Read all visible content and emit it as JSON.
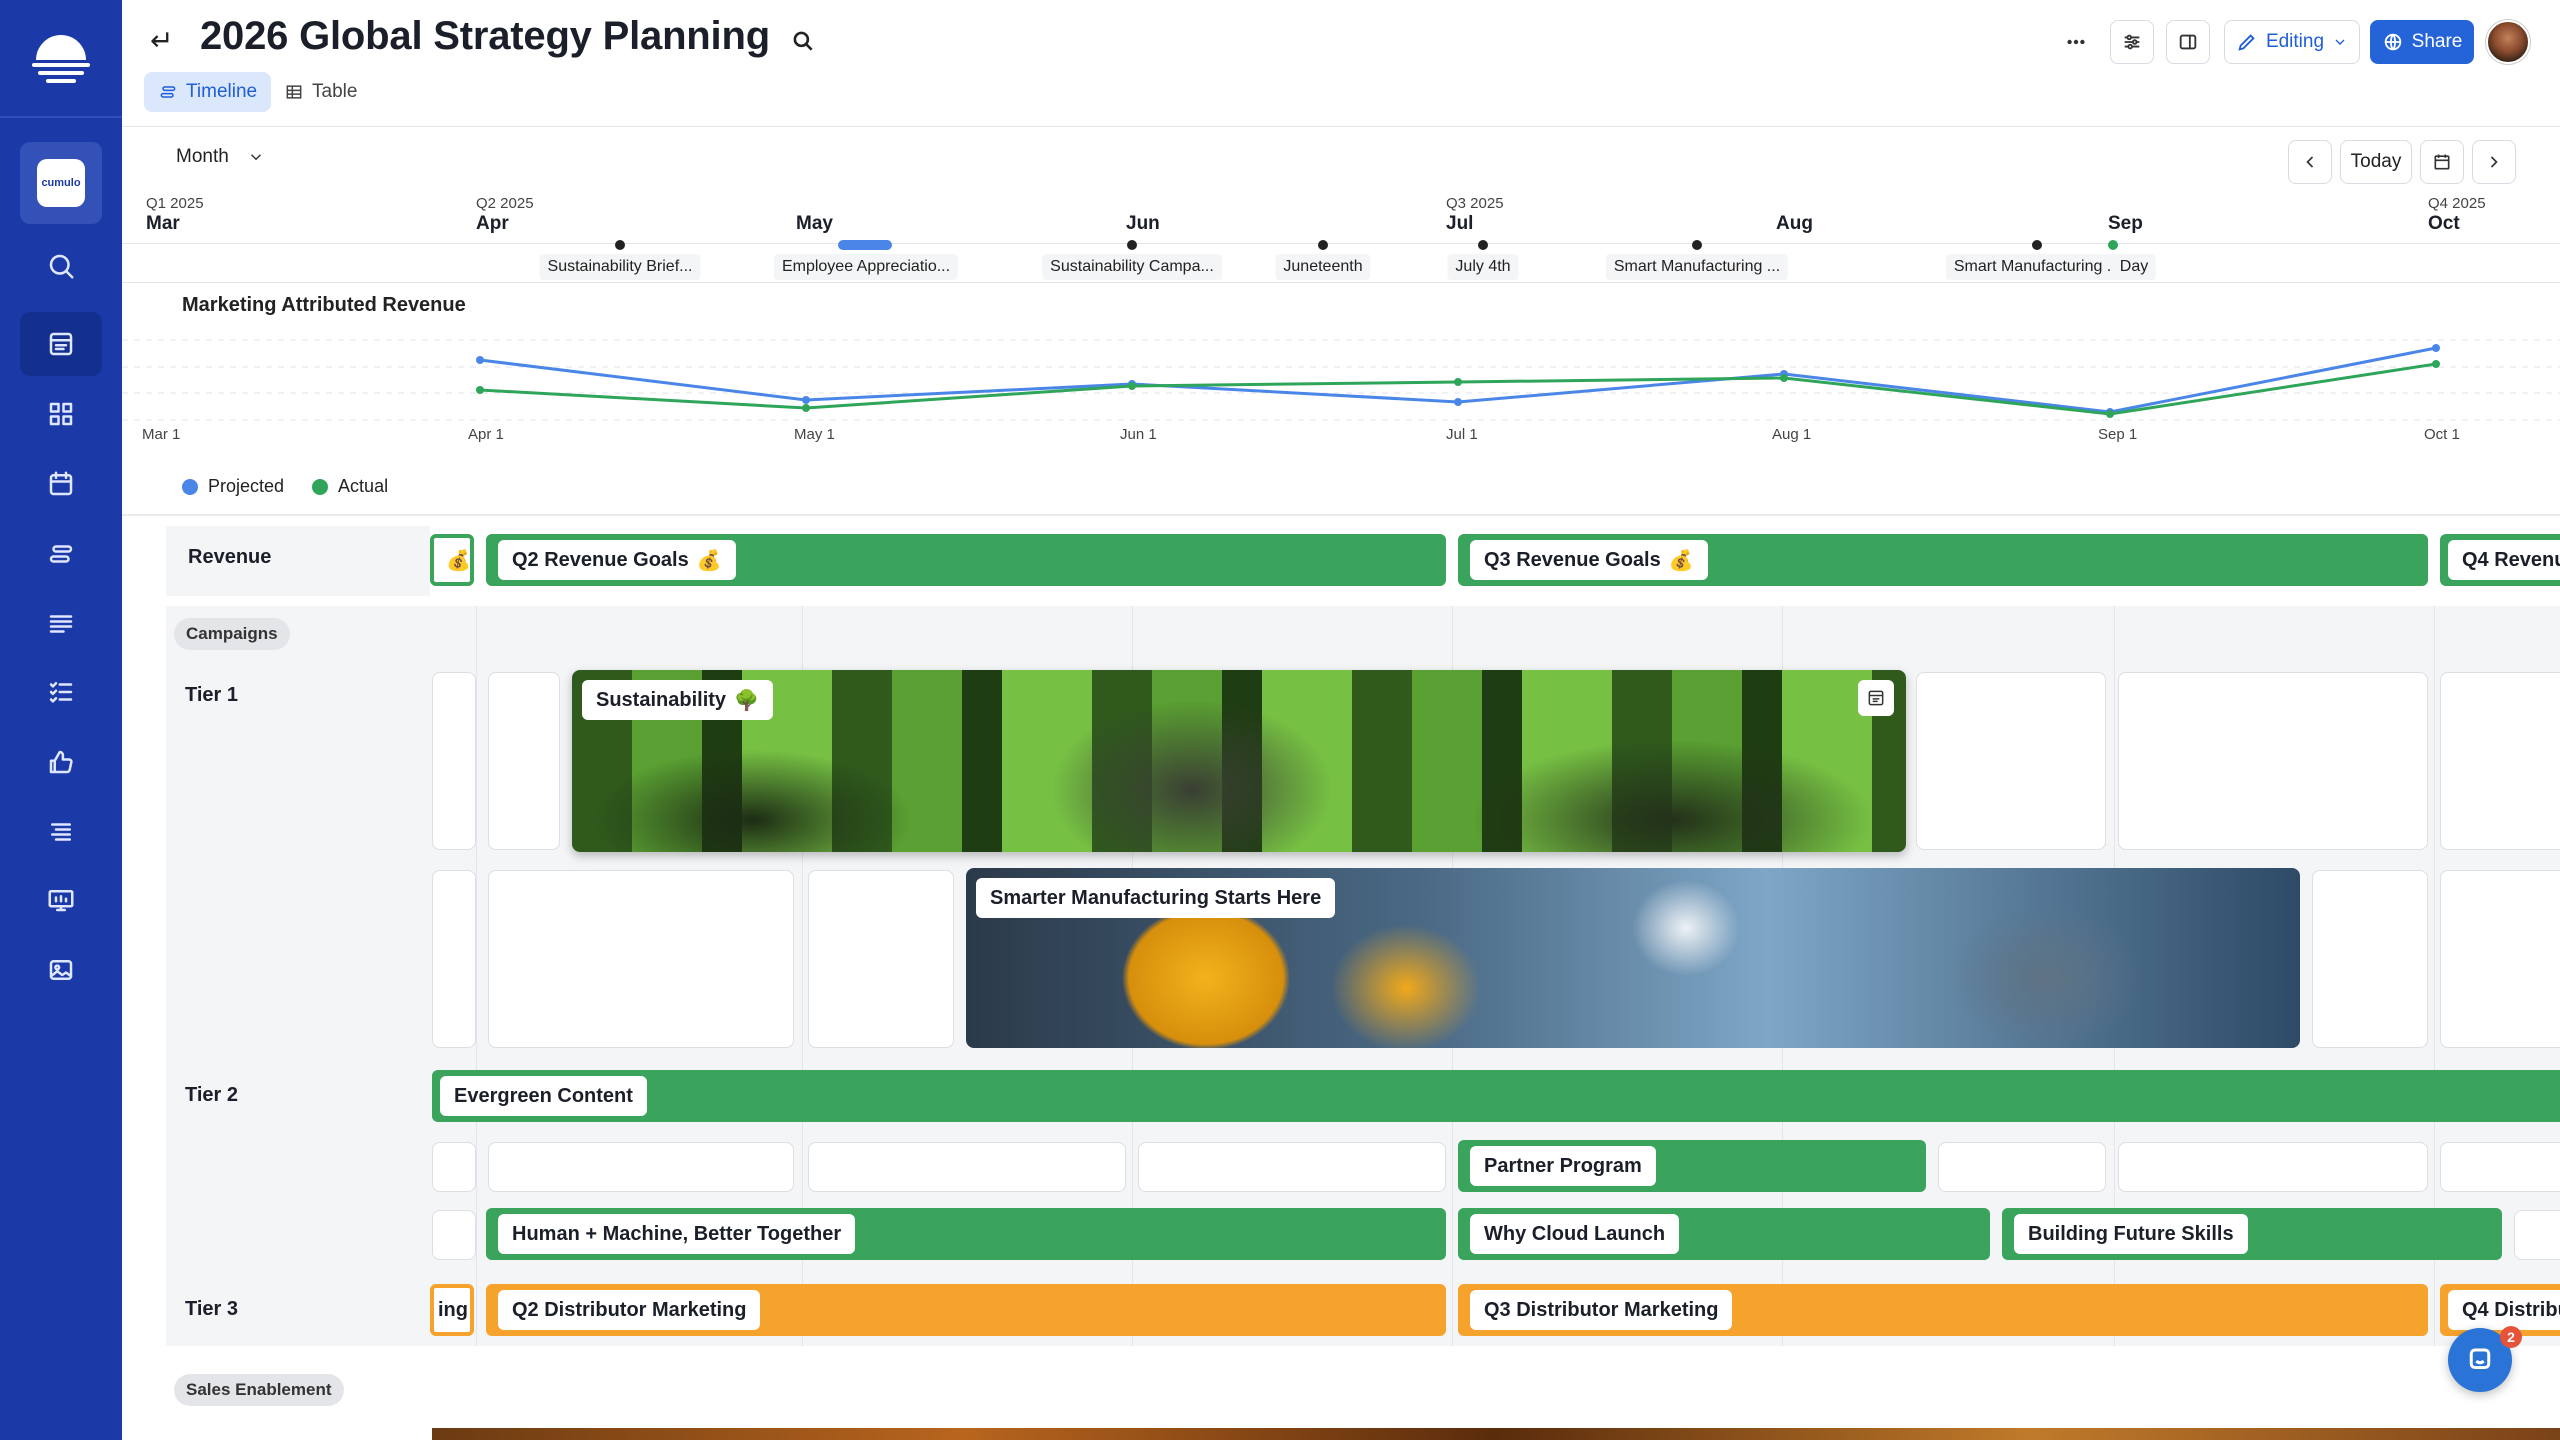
{
  "header": {
    "title": "2026 Global Strategy Planning",
    "views": [
      {
        "label": "Timeline",
        "active": true
      },
      {
        "label": "Table",
        "active": false
      }
    ],
    "editing_label": "Editing",
    "share_label": "Share"
  },
  "workspace": {
    "label": "cumulo"
  },
  "controls": {
    "zoom": "Month",
    "today_label": "Today"
  },
  "timeline": {
    "quarters": [
      "Q1 2025",
      "Q2 2025",
      "Q3 2025",
      "Q4 2025"
    ],
    "months": [
      "Mar",
      "Apr",
      "May",
      "Jun",
      "Jul",
      "Aug",
      "Sep",
      "Oct"
    ],
    "events": [
      "Sustainability Brief...",
      "Employee Appreciatio...",
      "Sustainability Campa...",
      "Juneteenth",
      "July 4th",
      "Smart Manufacturing ...",
      "Smart Manufacturing ...",
      "Day"
    ]
  },
  "chart_data": {
    "type": "line",
    "title": "Marketing Attributed Revenue",
    "x": [
      "Mar 1",
      "Apr 1",
      "May 1",
      "Jun 1",
      "Jul 1",
      "Aug 1",
      "Sep 1",
      "Oct 1"
    ],
    "series": [
      {
        "name": "Projected",
        "color": "#4a86e8",
        "values": [
          null,
          60,
          20,
          36,
          18,
          46,
          8,
          72
        ]
      },
      {
        "name": "Actual",
        "color": "#2fa55a",
        "values": [
          null,
          30,
          12,
          34,
          38,
          42,
          6,
          56
        ]
      }
    ],
    "ylim": [
      0,
      80
    ],
    "grid": true,
    "legend": "bottom-left"
  },
  "lanes": {
    "revenue": {
      "label": "Revenue",
      "bars": [
        {
          "label": "Q2 Revenue Goals",
          "emoji": "💰"
        },
        {
          "label": "Q3 Revenue Goals",
          "emoji": "💰"
        },
        {
          "label": "Q4 Revenu"
        }
      ]
    },
    "campaigns": {
      "chip": "Campaigns",
      "tier1": {
        "label": "Tier 1",
        "cards": [
          {
            "label": "Sustainability",
            "emoji": "🌳"
          },
          {
            "label": "Smarter Manufacturing Starts Here"
          }
        ]
      },
      "tier2": {
        "label": "Tier 2",
        "bars": [
          {
            "label": "Evergreen Content"
          },
          {
            "label": "Partner Program"
          },
          {
            "label": "Human + Machine, Better Together"
          },
          {
            "label": "Why Cloud Launch"
          },
          {
            "label": "Building Future Skills"
          }
        ]
      },
      "tier3": {
        "label": "Tier 3",
        "bars": [
          {
            "label": "ing"
          },
          {
            "label": "Q2 Distributor Marketing"
          },
          {
            "label": "Q3 Distributor Marketing"
          },
          {
            "label": "Q4 Distribu"
          }
        ]
      }
    },
    "sales": {
      "chip": "Sales Enablement"
    }
  },
  "support": {
    "badge": "2"
  },
  "colors": {
    "sidebar": "#1b3aa8",
    "accent": "#2563d9",
    "green": "#3aa35c",
    "orange": "#f5a32c"
  }
}
